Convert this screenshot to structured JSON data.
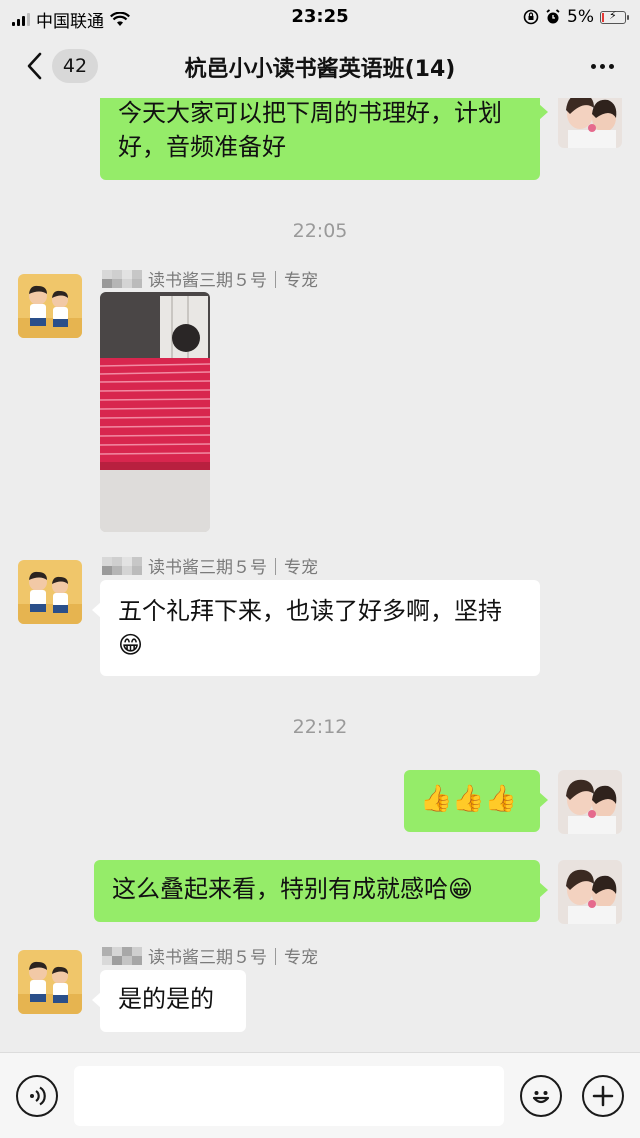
{
  "status_bar": {
    "carrier": "中国联通",
    "time": "23:25",
    "battery": "5%"
  },
  "nav": {
    "unread_count": "42",
    "title": "杭邑小小读书酱英语班(14)"
  },
  "messages": [
    {
      "type": "outgoing",
      "text": "今天大家可以把下周的书理好，计划好，音频准备好"
    },
    {
      "type": "time",
      "text": "22:05"
    },
    {
      "type": "incoming-image",
      "sender": "读书酱三期５号｜专宠"
    },
    {
      "type": "incoming",
      "sender": "读书酱三期５号｜专宠",
      "text": "五个礼拜下来，也读了好多啊，坚持😁"
    },
    {
      "type": "time",
      "text": "22:12"
    },
    {
      "type": "outgoing",
      "text": "👍👍👍"
    },
    {
      "type": "outgoing",
      "text": "这么叠起来看，特别有成就感哈😁"
    },
    {
      "type": "incoming",
      "sender": "读书酱三期５号｜专宠",
      "text": "是的是的"
    }
  ],
  "input_bar": {
    "voice_icon": "voice-icon",
    "emoji_icon": "emoji-icon",
    "plus_icon": "plus-icon"
  },
  "colors": {
    "background": "#ededed",
    "outgoing_bubble": "#95ec69",
    "incoming_bubble": "#ffffff"
  }
}
